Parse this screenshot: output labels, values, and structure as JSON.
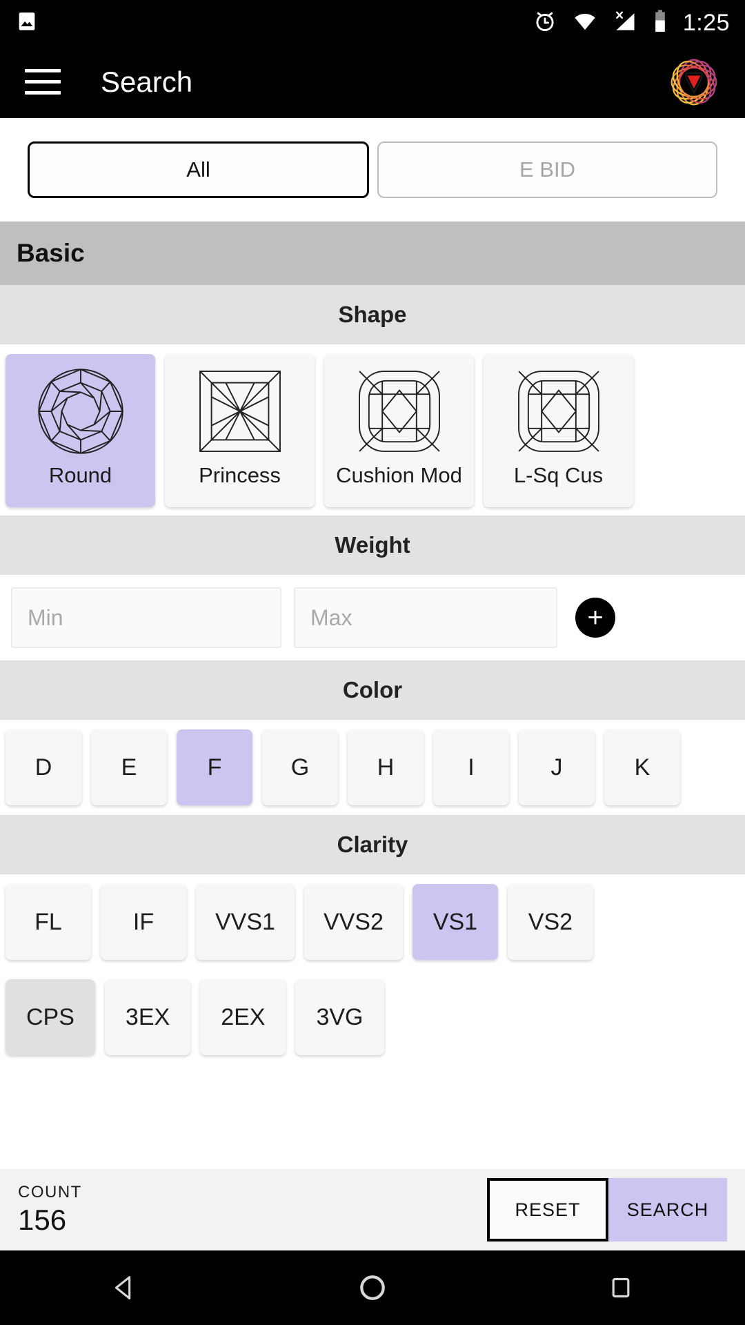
{
  "statusbar": {
    "time": "1:25",
    "icons": [
      "gallery-icon",
      "alarm-icon",
      "wifi-icon",
      "signal-no-sim-icon",
      "battery-icon"
    ]
  },
  "appbar": {
    "title": "Search",
    "menu_icon": "hamburger-menu-icon",
    "logo_icon": "app-logo-icon"
  },
  "tabs": [
    {
      "label": "All",
      "selected": true
    },
    {
      "label": "E BID",
      "selected": false
    }
  ],
  "sections": {
    "basic": "Basic",
    "shape": "Shape",
    "weight": "Weight",
    "color": "Color",
    "clarity": "Clarity"
  },
  "shapes": [
    {
      "label": "Round",
      "icon": "round-diamond-icon",
      "selected": true
    },
    {
      "label": "Princess",
      "icon": "princess-diamond-icon",
      "selected": false
    },
    {
      "label": "Cushion Mod",
      "icon": "cushion-mod-diamond-icon",
      "selected": false
    },
    {
      "label": "L-Sq Cus",
      "icon": "l-sq-cushion-diamond-icon",
      "selected": false
    }
  ],
  "weight": {
    "min_placeholder": "Min",
    "min_value": "",
    "max_placeholder": "Max",
    "max_value": "",
    "add_label": "+"
  },
  "colors": [
    {
      "label": "D",
      "selected": false
    },
    {
      "label": "E",
      "selected": false
    },
    {
      "label": "F",
      "selected": true
    },
    {
      "label": "G",
      "selected": false
    },
    {
      "label": "H",
      "selected": false
    },
    {
      "label": "I",
      "selected": false
    },
    {
      "label": "J",
      "selected": false
    },
    {
      "label": "K",
      "selected": false
    }
  ],
  "clarities": [
    {
      "label": "FL",
      "selected": false
    },
    {
      "label": "IF",
      "selected": false
    },
    {
      "label": "VVS1",
      "selected": false
    },
    {
      "label": "VVS2",
      "selected": false
    },
    {
      "label": "VS1",
      "selected": true
    },
    {
      "label": "VS2",
      "selected": false
    }
  ],
  "cuts": [
    {
      "label": "CPS",
      "selected": false,
      "dim": true
    },
    {
      "label": "3EX",
      "selected": false,
      "dim": false
    },
    {
      "label": "2EX",
      "selected": false,
      "dim": false
    },
    {
      "label": "3VG",
      "selected": false,
      "dim": false
    }
  ],
  "footer": {
    "count_label": "COUNT",
    "count_value": "156",
    "reset_label": "RESET",
    "search_label": "SEARCH"
  },
  "navbar": {
    "back": "back-triangle-icon",
    "home": "home-circle-icon",
    "recents": "recents-square-icon"
  },
  "theme": {
    "accent": "#cdc5ef",
    "appbar_bg": "#000000",
    "section_header_bg": "#bfbfbf",
    "sub_header_bg": "#e2e2e2",
    "chip_bg": "#f7f7f7",
    "footer_bg": "#f2f2f2"
  }
}
